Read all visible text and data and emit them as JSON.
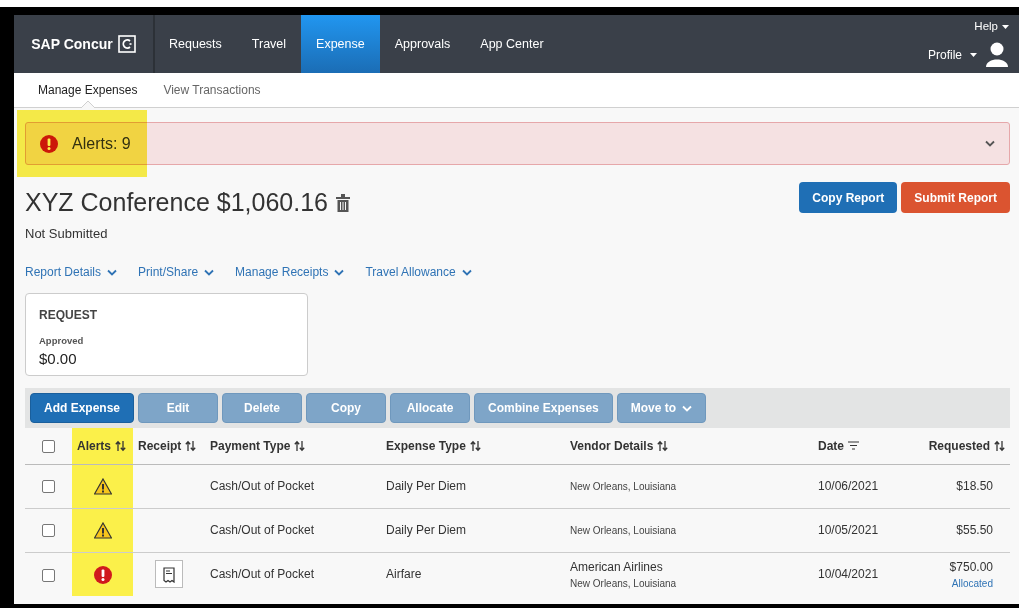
{
  "app": {
    "logo": "SAP Concur"
  },
  "nav": {
    "items": [
      {
        "label": "Requests",
        "selected": false
      },
      {
        "label": "Travel",
        "selected": false
      },
      {
        "label": "Expense",
        "selected": true
      },
      {
        "label": "Approvals",
        "selected": false
      },
      {
        "label": "App Center",
        "selected": false
      }
    ],
    "help": "Help",
    "profile": "Profile"
  },
  "subnav": [
    {
      "label": "Manage Expenses",
      "selected": true
    },
    {
      "label": "View Transactions",
      "selected": false
    }
  ],
  "alert_banner": {
    "text": "Alerts: 9",
    "highlighted": true,
    "expanded": false
  },
  "report": {
    "title": "XYZ Conference $1,060.16",
    "status": "Not Submitted",
    "actions": [
      {
        "label": "Copy Report",
        "kind": "primary"
      },
      {
        "label": "Submit Report",
        "kind": "danger"
      }
    ],
    "menus": [
      "Report Details",
      "Print/Share",
      "Manage Receipts",
      "Travel Allowance"
    ]
  },
  "request_card": {
    "heading": "REQUEST",
    "status": "Approved",
    "amount": "$0.00"
  },
  "toolbar": [
    {
      "label": "Add Expense",
      "disabled": false,
      "dropdown": false
    },
    {
      "label": "Edit",
      "disabled": true,
      "dropdown": false
    },
    {
      "label": "Delete",
      "disabled": true,
      "dropdown": false
    },
    {
      "label": "Copy",
      "disabled": true,
      "dropdown": false
    },
    {
      "label": "Allocate",
      "disabled": true,
      "dropdown": false
    },
    {
      "label": "Combine Expenses",
      "disabled": true,
      "dropdown": false
    },
    {
      "label": "Move to",
      "disabled": true,
      "dropdown": true
    }
  ],
  "table": {
    "select_all": {
      "checked": false
    },
    "columns": [
      {
        "label": "Alerts",
        "sorted": false,
        "highlighted": true
      },
      {
        "label": "Receipt",
        "sorted": false,
        "highlighted": false
      },
      {
        "label": "Payment Type",
        "sorted": false,
        "highlighted": false
      },
      {
        "label": "Expense Type",
        "sorted": false,
        "highlighted": false
      },
      {
        "label": "Vendor Details",
        "sorted": false,
        "highlighted": false
      },
      {
        "label": "Date",
        "sorted": true,
        "highlighted": false
      },
      {
        "label": "Requested",
        "sorted": false,
        "highlighted": false
      }
    ],
    "rows": [
      {
        "checked": false,
        "alert": {
          "kind": "warning"
        },
        "receipt": false,
        "payment_type": "Cash/Out of Pocket",
        "expense_type": "Daily Per Diem",
        "vendor_location": "New Orleans, Louisiana",
        "date": "10/06/2021",
        "requested": "$18.50"
      },
      {
        "checked": false,
        "alert": {
          "kind": "warning"
        },
        "receipt": false,
        "payment_type": "Cash/Out of Pocket",
        "expense_type": "Daily Per Diem",
        "vendor_location": "New Orleans, Louisiana",
        "date": "10/05/2021",
        "requested": "$55.50"
      },
      {
        "checked": false,
        "alert": {
          "kind": "error"
        },
        "receipt": true,
        "payment_type": "Cash/Out of Pocket",
        "expense_type": "Airfare",
        "vendor_name": "American Airlines",
        "vendor_location": "New Orleans, Louisiana",
        "date": "10/04/2021",
        "requested": "$750.00",
        "note": "Allocated"
      }
    ]
  }
}
